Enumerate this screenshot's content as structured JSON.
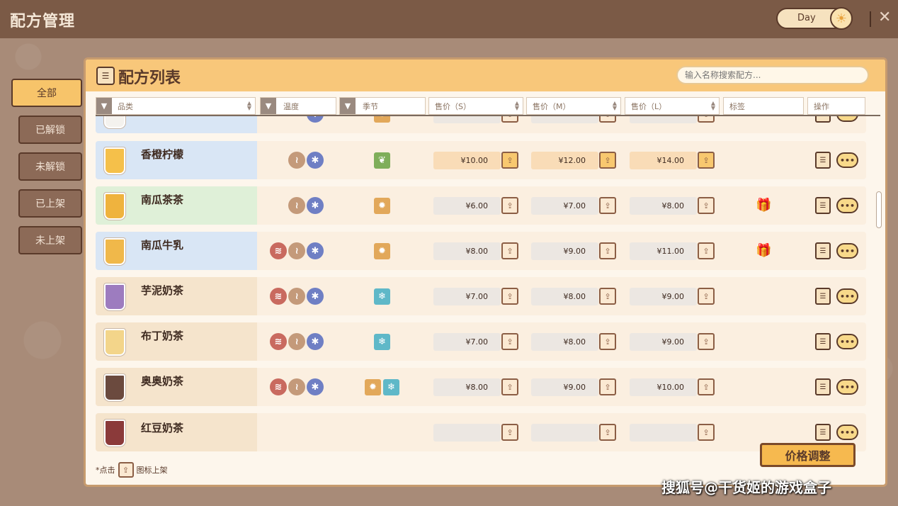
{
  "header": {
    "title": "配方管理",
    "toggle_label": "Day",
    "sun_glyph": "☀",
    "close_glyph": "✕"
  },
  "sidebar": {
    "items": [
      {
        "label": "全部",
        "active": true
      },
      {
        "label": "已解锁",
        "active": false
      },
      {
        "label": "未解锁",
        "active": false
      },
      {
        "label": "已上架",
        "active": false
      },
      {
        "label": "未上架",
        "active": false
      }
    ]
  },
  "panel": {
    "title": "配方列表",
    "icon_glyph": "☰",
    "search_placeholder": "输入名称搜索配方..."
  },
  "columns": {
    "category": "品类",
    "temperature": "温度",
    "season": "季节",
    "price_s": "售价（S）",
    "price_m": "售价（M）",
    "price_l": "售价（L）",
    "tag": "标签",
    "action": "操作"
  },
  "icons": {
    "hot": "≋",
    "warm": "≀",
    "cold": "✱",
    "spring": "❦",
    "autumn": "✹",
    "winter": "❄",
    "shelf": "⇪",
    "book": "☰",
    "more": "•••",
    "gift": "🎁"
  },
  "rows": [
    {
      "name": "",
      "bg": "#d9e6f5",
      "cup": "#f4f2ee",
      "temps": [
        "cold"
      ],
      "seasons": [
        "autumn"
      ],
      "prices": [
        "",
        "",
        ""
      ],
      "on_shelf": false,
      "gift": false,
      "partial": "top"
    },
    {
      "name": "香橙柠檬",
      "bg": "#d9e6f5",
      "cup": "#f5c04a",
      "temps": [
        "warm",
        "cold"
      ],
      "seasons": [
        "spring"
      ],
      "prices": [
        "¥10.00",
        "¥12.00",
        "¥14.00"
      ],
      "on_shelf": true,
      "gift": false
    },
    {
      "name": "南瓜茶茶",
      "bg": "#dff0d8",
      "cup": "#efb33e",
      "temps": [
        "warm",
        "cold"
      ],
      "seasons": [
        "autumn"
      ],
      "prices": [
        "¥6.00",
        "¥7.00",
        "¥8.00"
      ],
      "on_shelf": false,
      "gift": true
    },
    {
      "name": "南瓜牛乳",
      "bg": "#d9e6f5",
      "cup": "#f0b84a",
      "temps": [
        "hot",
        "warm",
        "cold"
      ],
      "seasons": [
        "autumn"
      ],
      "prices": [
        "¥8.00",
        "¥9.00",
        "¥11.00"
      ],
      "on_shelf": false,
      "gift": true
    },
    {
      "name": "芋泥奶茶",
      "bg": "#f5e4cc",
      "cup": "#9d7cbf",
      "temps": [
        "hot",
        "warm",
        "cold"
      ],
      "seasons": [
        "winter"
      ],
      "prices": [
        "¥7.00",
        "¥8.00",
        "¥9.00"
      ],
      "on_shelf": false,
      "gift": false
    },
    {
      "name": "布丁奶茶",
      "bg": "#f5e4cc",
      "cup": "#f3d58a",
      "temps": [
        "hot",
        "warm",
        "cold"
      ],
      "seasons": [
        "winter"
      ],
      "prices": [
        "¥7.00",
        "¥8.00",
        "¥9.00"
      ],
      "on_shelf": false,
      "gift": false
    },
    {
      "name": "奥奥奶茶",
      "bg": "#f5e4cc",
      "cup": "#6b4a3e",
      "temps": [
        "hot",
        "warm",
        "cold"
      ],
      "seasons": [
        "autumn",
        "winter"
      ],
      "prices": [
        "¥8.00",
        "¥9.00",
        "¥10.00"
      ],
      "on_shelf": false,
      "gift": false
    },
    {
      "name": "红豆奶茶",
      "bg": "#f5e4cc",
      "cup": "#8b3a3a",
      "temps": [],
      "seasons": [],
      "prices": [
        "",
        "",
        ""
      ],
      "on_shelf": false,
      "gift": false,
      "partial": "bottom"
    }
  ],
  "footer": {
    "hint_prefix": "*点击",
    "hint_suffix": "图标上架",
    "adjust_button": "价格调整"
  },
  "watermark": "搜狐号@干货姬的游戏盒子"
}
